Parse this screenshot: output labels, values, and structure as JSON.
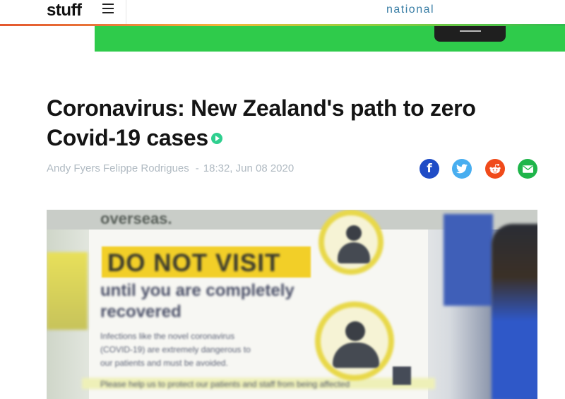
{
  "header": {
    "logo": "stuff",
    "section": "national"
  },
  "article": {
    "headline": "Coronavirus: New Zealand's path to zero Covid-19 cases",
    "authors": "Andy Fyers Felippe Rodrigues",
    "separator": "-",
    "timestamp": "18:32, Jun 08 2020"
  },
  "share": {
    "facebook_glyph": "f",
    "icons": [
      "facebook-icon",
      "twitter-icon",
      "reddit-icon",
      "email-icon"
    ],
    "colors": {
      "facebook": "#1f4cc6",
      "twitter": "#48aef0",
      "reddit": "#f04a1a",
      "email": "#1fb54a"
    }
  },
  "hero_image": {
    "top_text": "overseas.",
    "warning": "DO NOT VISIT",
    "line1": "until you are completely",
    "line2": "recovered",
    "paragraph": [
      "Infections like the novel coronavirus",
      "(COVID-19) are extremely dangerous to",
      "our patients and must be avoided."
    ],
    "footer": "Please help us to protect our patients and staff from being affected"
  },
  "colors": {
    "banner": "#2fcb4b",
    "section_label": "#3b7fa6",
    "play_icon": "#2fcf8f"
  }
}
